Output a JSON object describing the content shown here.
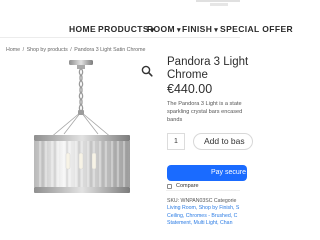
{
  "nav": {
    "home": "HOME",
    "products": "PRODUCTS",
    "room": "ROOM",
    "finish": "FINISH",
    "special": "SPECIAL OFFER"
  },
  "breadcrumb": {
    "home": "Home",
    "shop": "Shop by products",
    "current": "Pandora 3 Light Satin Chrome"
  },
  "product": {
    "title_line1": "Pandora 3 Light",
    "title_line2": "Chrome",
    "price": "€440.00",
    "desc_line1": "The Pandora 3 Light is a state",
    "desc_line2": "sparkling crystal bars encased",
    "desc_line3": "bands",
    "qty": "1",
    "add_label": "Add to bas",
    "pay_label": "Pay secure",
    "compare_label": "Compare"
  },
  "meta": {
    "sku_line": "SKU: WNPAN03SC  Categorie",
    "line2": "Living Room, Shop by Finish, S",
    "line3": "Ceiling, Chromes - Brushed, C",
    "line4": "Statement, Multi Light, Chan"
  },
  "colors": {
    "accent": "#1a6bff",
    "link": "#2a7be4",
    "text": "#2d2d2d"
  },
  "icons": {
    "zoom": "magnifier-icon",
    "gallery": "pendant-lamp-image"
  }
}
